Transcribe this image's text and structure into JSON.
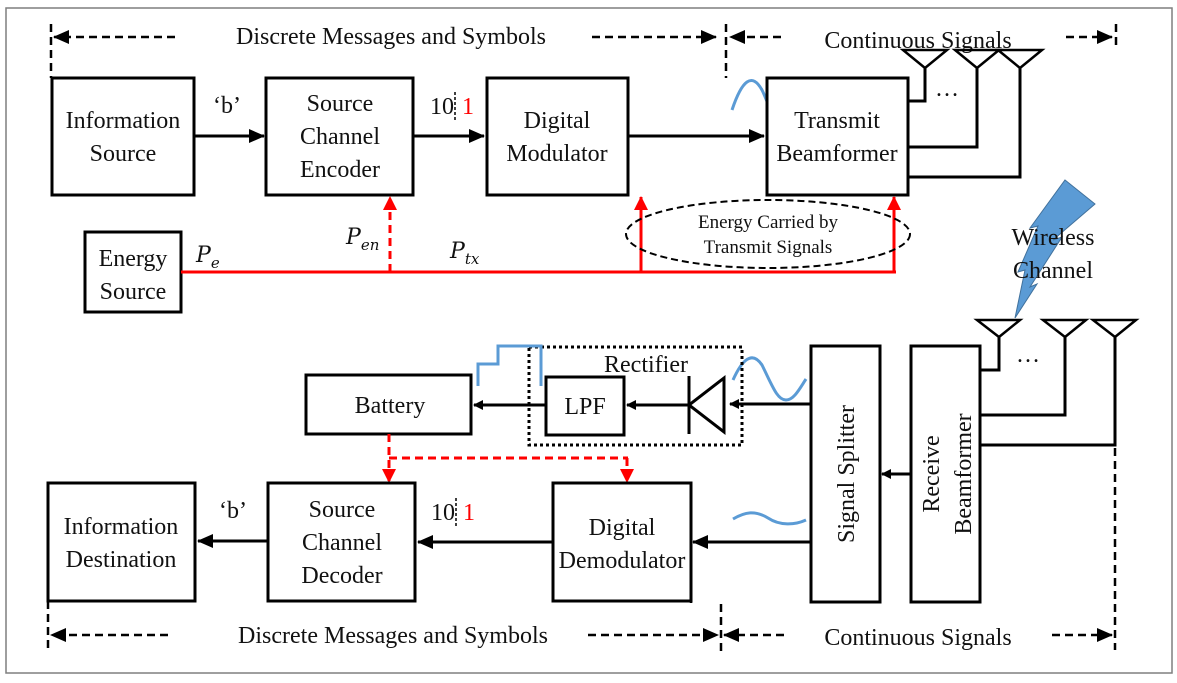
{
  "colors": {
    "power_line": "#ff0000",
    "signal_wave": "#5b9bd5",
    "lightning": "#5b9bd5",
    "box_stroke": "#000000",
    "frame_stroke": "#7f7f7f",
    "highlight_bit": "#ff0000"
  },
  "regions": {
    "top_discrete": "Discrete Messages and Symbols",
    "top_continuous": "Continuous Signals",
    "bottom_discrete": "Discrete Messages and Symbols",
    "bottom_continuous": "Continuous Signals"
  },
  "transmitter": {
    "info_source": [
      "Information",
      "Source"
    ],
    "encoder": [
      "Source",
      "Channel",
      "Encoder"
    ],
    "modulator": [
      "Digital",
      "Modulator"
    ],
    "tx_beamformer": [
      "Transmit",
      "Beamformer"
    ],
    "symbol_label": "‘b’",
    "bits_black": "10",
    "bits_red": "1",
    "antenna_ellipsis": "…"
  },
  "energy": {
    "source": [
      "Energy",
      "Source"
    ],
    "pe": {
      "base": "P",
      "sub": "e"
    },
    "pen": {
      "base": "P",
      "sub": "en"
    },
    "ptx": {
      "base": "P",
      "sub": "tx"
    },
    "annotation": [
      "Energy Carried by",
      "Transmit Signals"
    ]
  },
  "channel": {
    "label": [
      "Wireless",
      "Channel"
    ]
  },
  "receiver": {
    "rectifier_label": "Rectifier",
    "lpf": "LPF",
    "battery": "Battery",
    "splitter": "Signal Splitter",
    "rx_beamformer": [
      "Receive",
      "Beamformer"
    ],
    "demodulator": [
      "Digital",
      "Demodulator"
    ],
    "decoder": [
      "Source",
      "Channel",
      "Decoder"
    ],
    "info_destination": [
      "Information",
      "Destination"
    ],
    "symbol_label": "‘b’",
    "bits_black": "10",
    "bits_red": "1",
    "antenna_ellipsis": "…"
  }
}
